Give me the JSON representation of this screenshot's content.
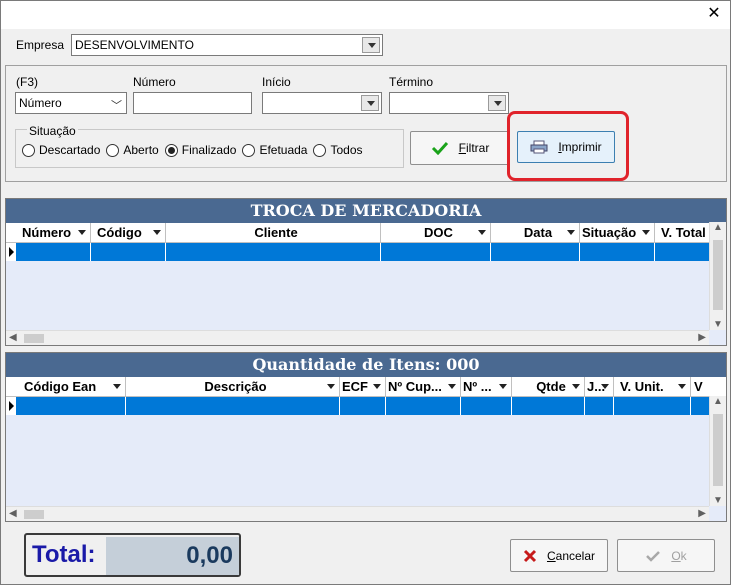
{
  "window": {
    "close_glyph": "✕"
  },
  "empresa": {
    "label": "Empresa",
    "value": "DESENVOLVIMENTO"
  },
  "filter": {
    "field_label": "(F3)",
    "field_value": "Número",
    "numero_label": "Número",
    "numero_value": "",
    "inicio_label": "Início",
    "inicio_value": "",
    "termino_label": "Término",
    "termino_value": ""
  },
  "situacao": {
    "label": "Situação",
    "options": [
      {
        "label": "Descartado",
        "selected": false
      },
      {
        "label": "Aberto",
        "selected": false
      },
      {
        "label": "Finalizado",
        "selected": true
      },
      {
        "label": "Efetuada",
        "selected": false
      },
      {
        "label": "Todos",
        "selected": false
      }
    ]
  },
  "buttons": {
    "filtrar_first": "F",
    "filtrar_rest": "iltrar",
    "imprimir_first": "I",
    "imprimir_rest": "mprimir",
    "cancelar_first": "C",
    "cancelar_rest": "ancelar",
    "ok_first": "O",
    "ok_rest": "k"
  },
  "grid1": {
    "title": "TROCA DE MERCADORIA",
    "columns": [
      "Número",
      "Código",
      "Cliente",
      "DOC",
      "Data",
      "Situação",
      "V. Total"
    ]
  },
  "grid2": {
    "title": "Quantidade de Itens: 000",
    "columns": [
      "Código Ean",
      "Descrição",
      "ECF",
      "Nº Cup...",
      "Nº ...",
      "Qtde",
      "J...",
      "V. Unit.",
      "V"
    ]
  },
  "total": {
    "label": "Total:",
    "value": "0,00"
  },
  "colors": {
    "grid_title_bg": "#4a6991",
    "selected_row": "#0078d7",
    "highlight": "#e0232b",
    "total_label": "#1a1aa8"
  }
}
